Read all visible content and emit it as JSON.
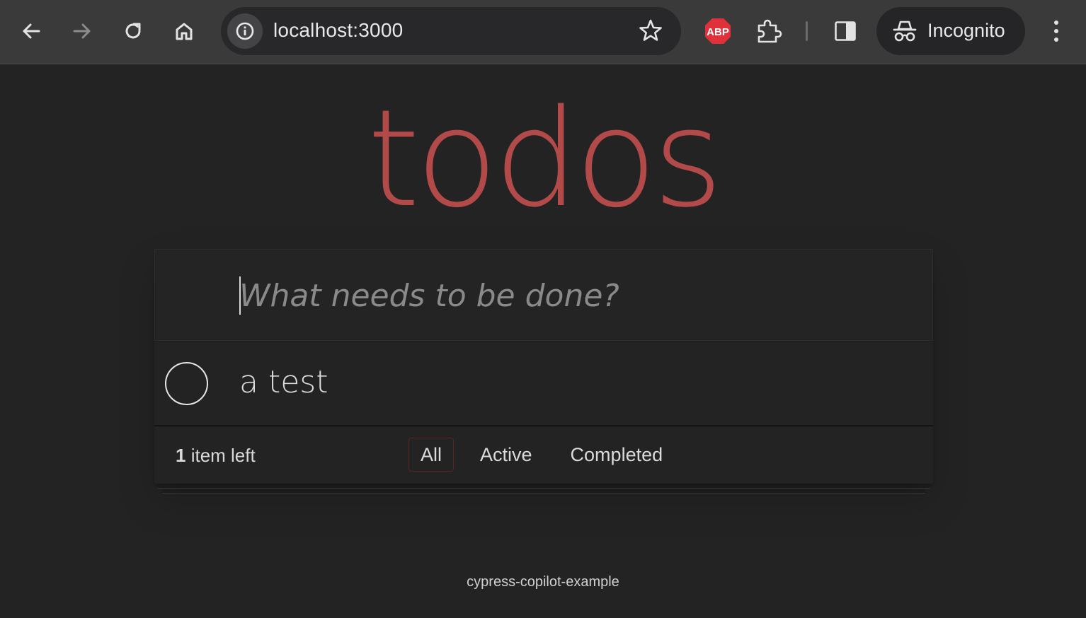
{
  "browser": {
    "url": "localhost:3000",
    "profile_label": "Incognito",
    "adblock_badge": "ABP",
    "icons": {
      "back": "arrow-left-icon",
      "forward": "arrow-right-icon",
      "reload": "reload-icon",
      "home": "home-icon",
      "site_info": "info-icon",
      "bookmark": "star-icon",
      "adblock": "adblock-icon",
      "extensions": "puzzle-icon",
      "side_panel": "side-panel-icon",
      "incognito": "incognito-icon",
      "menu": "kebab-menu-icon"
    }
  },
  "app": {
    "title": "todos",
    "new_todo_placeholder": "What needs to be done?",
    "todos": [
      {
        "label": "a test",
        "completed": false
      }
    ],
    "footer": {
      "count": "1",
      "count_suffix": " item left",
      "filters": [
        "All",
        "Active",
        "Completed"
      ],
      "selected_filter": "All"
    },
    "info": "cypress-copilot-example"
  },
  "colors": {
    "title": "#b34a4a",
    "page_bg": "#232323",
    "toolbar_bg": "#3a3a3b",
    "adblock_red": "#e0303a"
  }
}
